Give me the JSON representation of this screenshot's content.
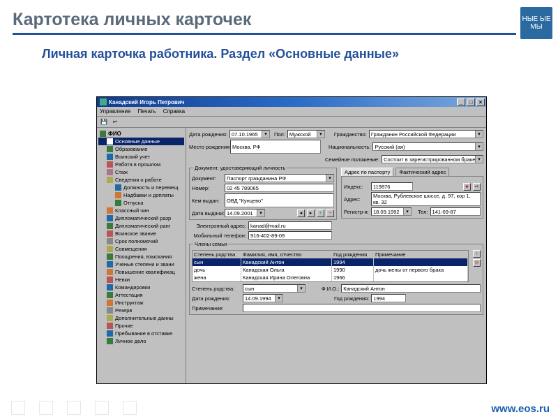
{
  "slide": {
    "title": "Картотека личных карточек",
    "subtitle": "Личная карточка работника. Раздел «Основные данные»",
    "brand_badge": "НЫЕ ЫЕ МЫ",
    "footer": "www.eos.ru"
  },
  "window": {
    "title": "Канадский Игорь Петрович",
    "menu": [
      "Управление",
      "Печать",
      "Справка"
    ]
  },
  "tree": {
    "root": "ФИО",
    "items": [
      {
        "label": "Основные данные",
        "selected": true,
        "color": "#fff"
      },
      {
        "label": "Образование",
        "color": "#3a7a3a"
      },
      {
        "label": "Воинский учет",
        "color": "#1e6aa8"
      },
      {
        "label": "Работа в прошлом",
        "color": "#b55"
      },
      {
        "label": "Стаж",
        "color": "#a78"
      },
      {
        "label": "Сведения о работе",
        "color": "#aa5",
        "expanded": true
      },
      {
        "label": "Должность и перемещ",
        "l2": true,
        "color": "#1e6aa8"
      },
      {
        "label": "Надбавки и доплаты",
        "l2": true,
        "color": "#c73"
      },
      {
        "label": "Отпуска",
        "l2": true,
        "color": "#3a7a3a"
      },
      {
        "label": "Классный чин",
        "color": "#c73"
      },
      {
        "label": "Дипломатический разр",
        "color": "#1e6aa8"
      },
      {
        "label": "Дипломатический ранг",
        "color": "#3a7a3a"
      },
      {
        "label": "Воинское звание",
        "color": "#b55"
      },
      {
        "label": "Срок полномочий",
        "color": "#888"
      },
      {
        "label": "Совмещения",
        "color": "#aa5"
      },
      {
        "label": "Поощрения, взыскания",
        "color": "#3a7a3a"
      },
      {
        "label": "Ученые степени и звани",
        "color": "#1e6aa8"
      },
      {
        "label": "Повышение квалификац",
        "color": "#c73"
      },
      {
        "label": "Невки",
        "color": "#b55"
      },
      {
        "label": "Командировки",
        "color": "#1e6aa8"
      },
      {
        "label": "Аттестация",
        "color": "#3a7a3a"
      },
      {
        "label": "Инструктаж",
        "color": "#c73"
      },
      {
        "label": "Резерв",
        "color": "#888"
      },
      {
        "label": "Дополнительные данны",
        "color": "#aa5"
      },
      {
        "label": "Прочие",
        "color": "#b55"
      },
      {
        "label": "Пребывание в отставке",
        "color": "#1e6aa8"
      },
      {
        "label": "Личное дело",
        "color": "#3a7a3a"
      }
    ]
  },
  "form": {
    "birth_date_label": "Дата рождения:",
    "birth_date": "07.10.1965",
    "sex_label": "Пол:",
    "sex": "Мужской",
    "citizenship_label": "Гражданство:",
    "citizenship": "Гражданин Российской Федерации",
    "birth_place_label": "Место рождения:",
    "birth_place": "Москва, РФ",
    "nationality_label": "Национальность:",
    "nationality": "Русский (ая)",
    "marital_label": "Семейное положение:",
    "marital": "Состоит в зарегистрированном браке",
    "doc_group": "Документ, удостоверяющий личность",
    "doc_label": "Документ:",
    "doc": "Паспорт гражданина РФ",
    "number_label": "Номер:",
    "number": "02 45 789065",
    "issued_by_label": "Кем выдан:",
    "issued_by": "ОВД \"Кунцево\"",
    "issue_date_label": "Дата выдачи:",
    "issue_date": "14.09.2001",
    "addr_tab1": "Адрес по паспорту",
    "addr_tab2": "Фактический адрес",
    "index_label": "Индекс:",
    "index": "119876",
    "addr_label": "Адрес:",
    "addr": "Москва, Рублевское шоссе, д. 97, кор 1, кв. 32",
    "reg_label": "Регистр-я:",
    "reg": "18.09.1992",
    "tel_label": "Тел:",
    "tel": "141-09-87",
    "email_label": "Электронный адрес:",
    "email": "kanad@mail.ru",
    "mobile_label": "Мобильный телефон:",
    "mobile": "916-402-89-09",
    "family_group": "Члены семьи",
    "fam_headers": [
      "Степень родства",
      "Фамилия, имя, отчество",
      "Год рождения",
      "Примечание"
    ],
    "fam_rows": [
      {
        "rel": "сын",
        "name": "Канадский Антон",
        "year": "1994",
        "note": "",
        "sel": true
      },
      {
        "rel": "дочь",
        "name": "Канадская Ольга",
        "year": "1990",
        "note": "дочь жены от первого брака"
      },
      {
        "rel": "жена",
        "name": "Канадская Ирина Олеговна",
        "year": "1966",
        "note": ""
      }
    ],
    "detail_rel_label": "Степень родства:",
    "detail_rel": "сын",
    "detail_fio_label": "Ф.И.О.:",
    "detail_fio": "Канадский Антон",
    "detail_bd_label": "Дата рождения:",
    "detail_bd": "14.09.1994",
    "detail_year_label": "Год рождения:",
    "detail_year": "1994",
    "detail_note_label": "Примечание:"
  }
}
